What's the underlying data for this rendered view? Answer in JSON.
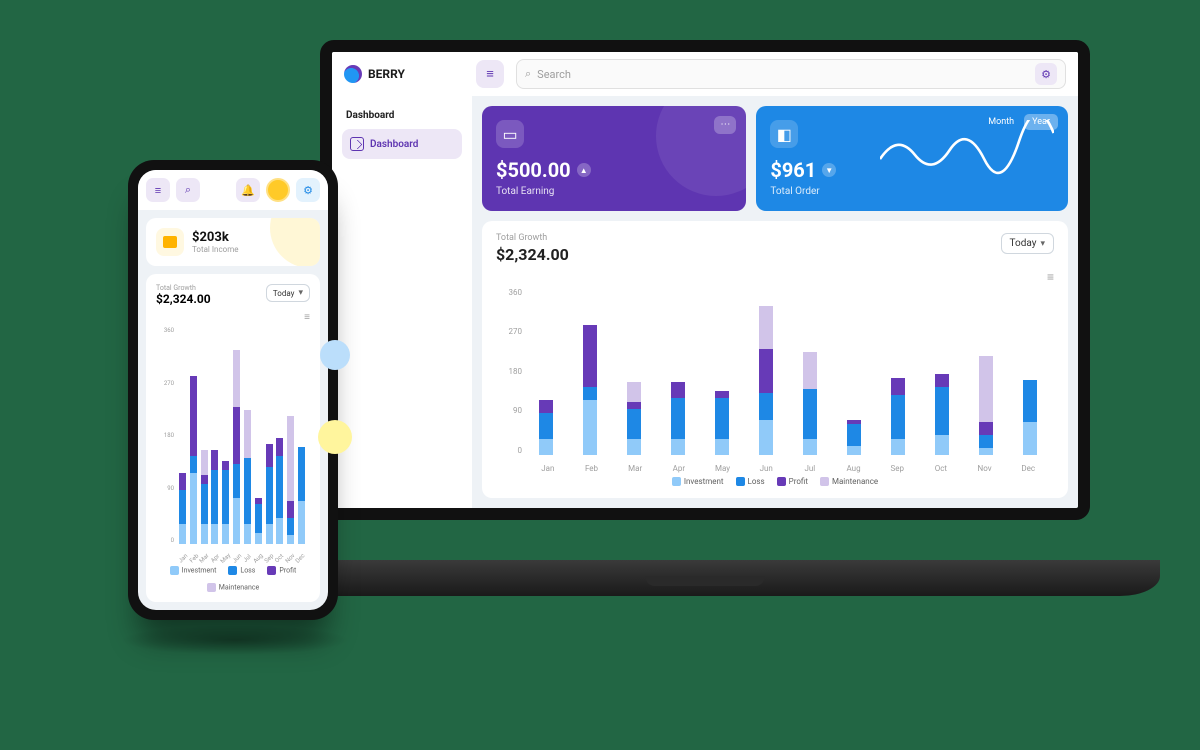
{
  "app": {
    "brand": "BERRY",
    "search_placeholder": "Search",
    "sidebar": {
      "heading": "Dashboard",
      "items": [
        "Dashboard"
      ]
    }
  },
  "cards": {
    "earning": {
      "value": "$500.00",
      "label": "Total Earning"
    },
    "order": {
      "value": "$961",
      "label": "Total Order",
      "segments": [
        "Month",
        "Year"
      ],
      "active": "Year"
    }
  },
  "growth": {
    "title": "Total Growth",
    "amount": "$2,324.00",
    "period": "Today"
  },
  "phone": {
    "income": {
      "value": "$203k",
      "label": "Total Income"
    }
  },
  "legend": {
    "investment": "Investment",
    "loss": "Loss",
    "profit": "Profit",
    "maintenance": "Maintenance"
  },
  "chart_data": {
    "type": "bar",
    "title": "Total Growth",
    "ylabel": "",
    "ylim": [
      0,
      380
    ],
    "yticks": [
      0,
      90,
      180,
      270,
      360
    ],
    "categories": [
      "Jan",
      "Feb",
      "Mar",
      "Apr",
      "May",
      "Jun",
      "Jul",
      "Aug",
      "Sep",
      "Oct",
      "Nov",
      "Dec"
    ],
    "series": [
      {
        "name": "Investment",
        "color": "#90caf9",
        "values": [
          35,
          125,
          35,
          35,
          35,
          80,
          35,
          20,
          35,
          45,
          15,
          75
        ]
      },
      {
        "name": "Loss",
        "color": "#1e88e5",
        "values": [
          60,
          30,
          70,
          95,
          95,
          60,
          115,
          50,
          100,
          110,
          30,
          95
        ]
      },
      {
        "name": "Profit",
        "color": "#673ab7",
        "values": [
          30,
          140,
          15,
          35,
          15,
          100,
          0,
          10,
          40,
          30,
          30,
          0
        ]
      },
      {
        "name": "Maintenance",
        "color": "#d1c4e9",
        "values": [
          0,
          0,
          45,
          0,
          0,
          100,
          85,
          0,
          0,
          0,
          150,
          0
        ]
      }
    ]
  }
}
